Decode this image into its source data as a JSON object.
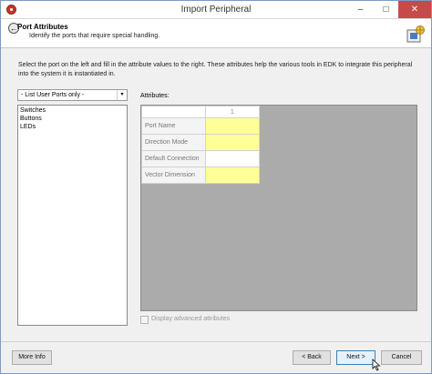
{
  "window": {
    "title": "Import Peripheral"
  },
  "header": {
    "title": "Port Attributes",
    "subtitle": "Identify the ports that require special handling."
  },
  "description": "Select the port on the left and fill in the attribute values to the right. These attributes help the various tools in EDK to integrate this peripheral into the system it is instantiated in.",
  "ports": {
    "filter_selected": "- List User Ports only -",
    "items": [
      "Switches",
      "Buttons",
      "LEDs"
    ]
  },
  "attributes": {
    "label": "Attributes:",
    "column_header": "1",
    "rows": [
      {
        "name": "Port Name",
        "value": "",
        "required": true
      },
      {
        "name": "Direction Mode",
        "value": "",
        "required": true
      },
      {
        "name": "Default Connection",
        "value": "",
        "required": false
      },
      {
        "name": "Vector Dimension",
        "value": "",
        "required": true
      }
    ],
    "highlight_color": "#ffff99",
    "advanced_label": "Display advanced attributes",
    "advanced_checked": false
  },
  "buttons": {
    "more_info": "More Info",
    "back": "< Back",
    "next": "Next >",
    "cancel": "Cancel"
  },
  "controls": {
    "minimize": "–",
    "maximize": "□",
    "close": "✕",
    "back_glyph": "←",
    "combo_arrow": "▾"
  }
}
